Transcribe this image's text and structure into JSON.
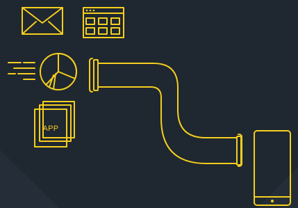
{
  "colors": {
    "background": "#1f2730",
    "background_facet": "#252e38",
    "accent": "#f5cf1f"
  },
  "icons": {
    "envelope": "envelope-icon",
    "app_grid": "app-grid-window-icon",
    "pie_chart": "pie-chart-icon",
    "app_stack": "app-stack-icon",
    "pipe": "pipe-icon",
    "tablet": "tablet-icon"
  },
  "app_stack": {
    "label": "APP"
  }
}
